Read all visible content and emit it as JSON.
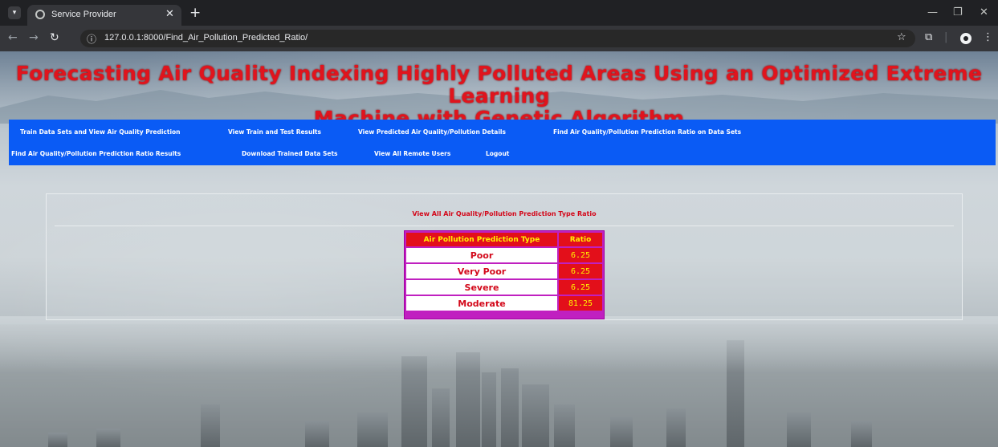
{
  "browser": {
    "tab_title": "Service Provider",
    "url": "127.0.0.1:8000/Find_Air_Pollution_Predicted_Ratio/"
  },
  "site": {
    "title_line1": "Forecasting Air Quality Indexing Highly Polluted Areas Using an Optimized Extreme Learning",
    "title_line2": "Machine with Genetic Algorithm"
  },
  "nav": {
    "items": [
      "Train Data Sets and View Air Quality Prediction",
      "View Train and Test Results",
      "View Predicted Air Quality/Pollution Details",
      "Find Air Quality/Pollution Prediction Ratio on Data Sets",
      "Find Air Quality/Pollution Prediction Ratio Results",
      "Download Trained Data Sets",
      "View All Remote Users",
      "Logout"
    ]
  },
  "main": {
    "heading": "View All Air Quality/Pollution Prediction Type Ratio",
    "table": {
      "headers": [
        "Air Pollution Prediction Type",
        "Ratio"
      ],
      "rows": [
        {
          "type": "Poor",
          "ratio": "6.25"
        },
        {
          "type": "Very Poor",
          "ratio": "6.25"
        },
        {
          "type": "Severe",
          "ratio": "6.25"
        },
        {
          "type": "Moderate",
          "ratio": "81.25"
        }
      ]
    }
  },
  "colors": {
    "title_red": "#e0141d",
    "nav_blue": "#0a5bf5",
    "table_border": "#c020c0",
    "cell_red": "#e30f1a",
    "cell_yellow": "#fff200"
  }
}
